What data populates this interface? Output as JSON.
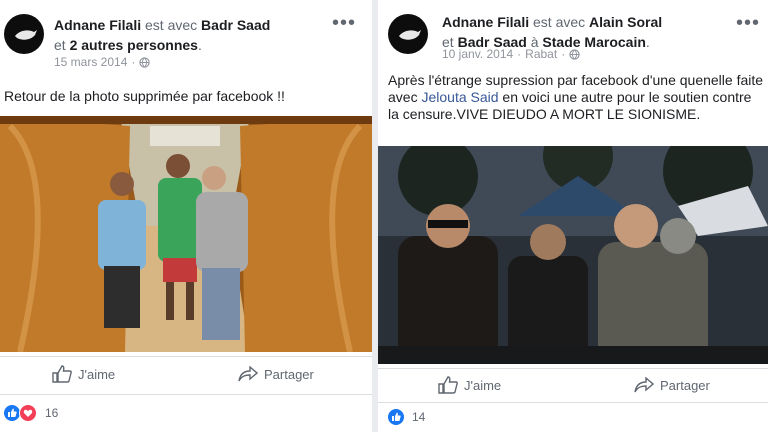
{
  "posts": [
    {
      "author": "Adnane Filali",
      "with_text": "est avec",
      "tagged": "Badr Saad",
      "and_text": "et",
      "others": "2 autres personnes",
      "period": ".",
      "date": "15 mars 2014",
      "caption": "Retour de la photo supprimée par facebook !!",
      "like_label": "J'aime",
      "share_label": "Partager",
      "reaction_count": "16"
    },
    {
      "author": "Adnane Filali",
      "with_text": "est avec",
      "tagged1": "Alain Soral",
      "and_text": "et",
      "tagged2": "Badr Saad",
      "at_text": "à",
      "place": "Stade Marocain",
      "period": ".",
      "date": "10 janv. 2014",
      "location": "Rabat",
      "caption_part1": "Après l'étrange supression par facebook d'une quenelle faite avec",
      "caption_tag": "Jelouta Said",
      "caption_part2": "en voici une autre pour le soutien contre la censure.VIVE DIEUDO A MORT LE SIONISME.",
      "like_label": "J'aime",
      "share_label": "Partager",
      "reaction_count": "14"
    }
  ],
  "colors": {
    "link": "#385898",
    "like": "#1877f2",
    "love": "#f33e58"
  }
}
